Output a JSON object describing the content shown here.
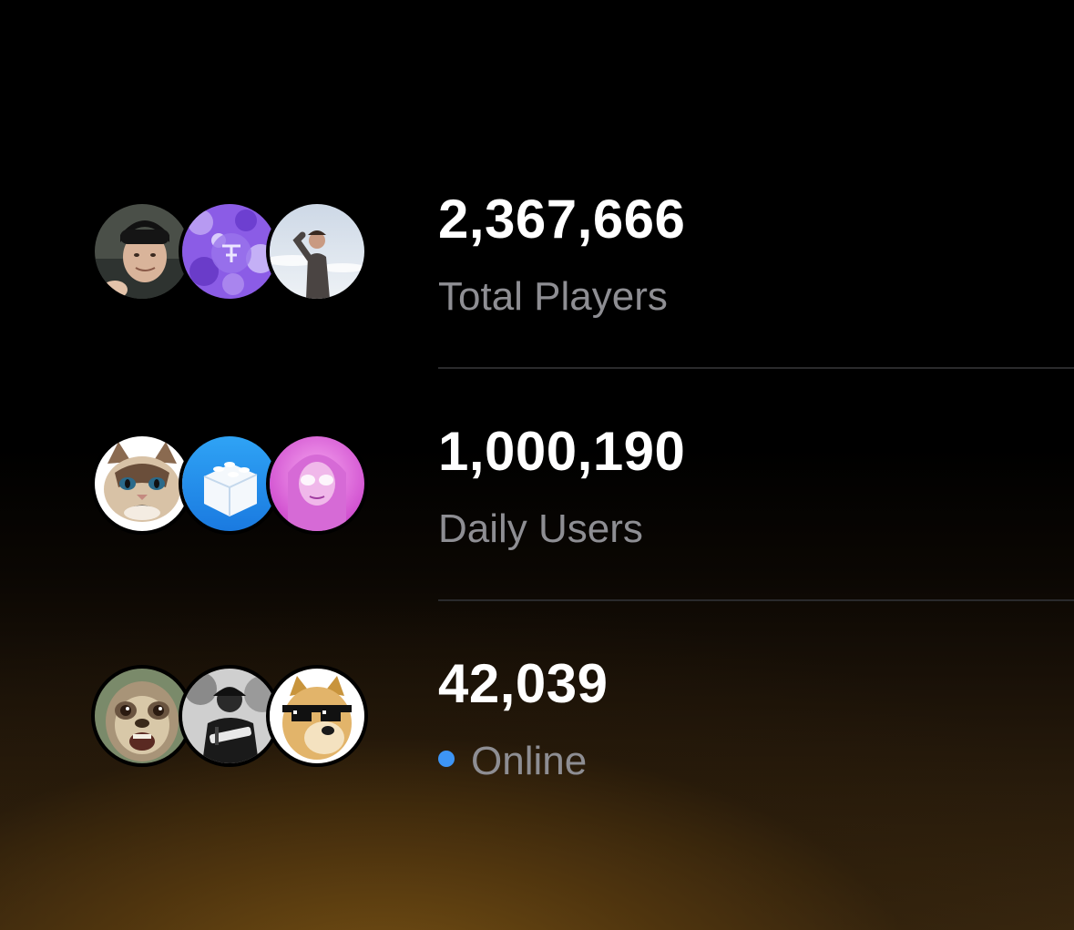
{
  "stats": [
    {
      "value": "2,367,666",
      "label": "Total Players",
      "avatars": [
        "man-beanie-avatar",
        "purple-pattern-avatar",
        "man-sky-avatar"
      ]
    },
    {
      "value": "1,000,190",
      "label": "Daily Users",
      "avatars": [
        "grumpy-cat-avatar",
        "blue-block-app-avatar",
        "pink-woman-avatar"
      ]
    },
    {
      "value": "42,039",
      "label": "Online",
      "avatars": [
        "sloth-avatar",
        "bw-musician-avatar",
        "doge-sunglasses-avatar"
      ]
    }
  ],
  "colors": {
    "value_text": "#ffffff",
    "label_text": "#8e8e93",
    "online_dot": "#3d95f5",
    "divider": "#2a2a2c",
    "glow": "#7a5214"
  }
}
